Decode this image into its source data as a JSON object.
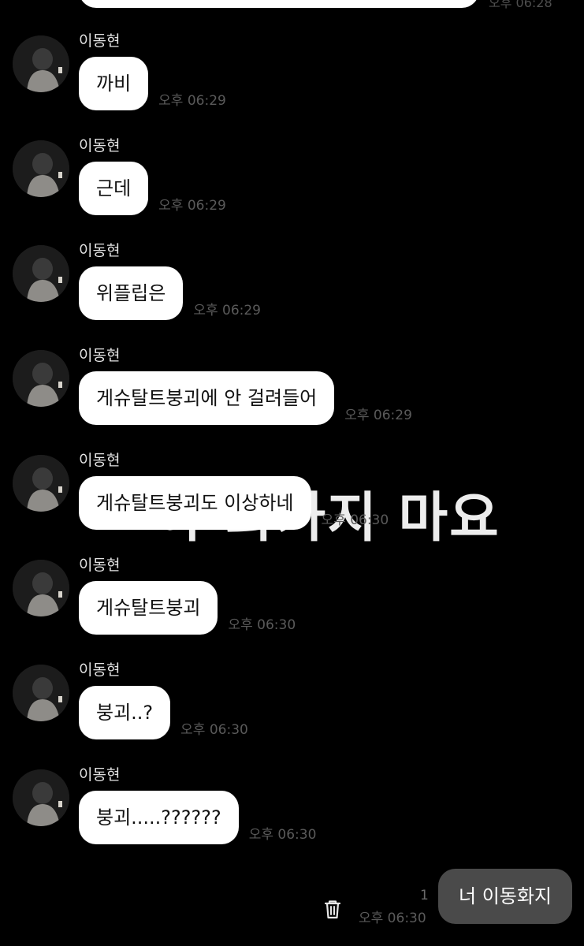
{
  "top": {
    "time_partial": "오후 06:28"
  },
  "messages": [
    {
      "sender": "이동현",
      "text": "까비",
      "time": "오후 06:29"
    },
    {
      "sender": "이동현",
      "text": "근데",
      "time": "오후 06:29"
    },
    {
      "sender": "이동현",
      "text": "위플립은",
      "time": "오후 06:29"
    },
    {
      "sender": "이동현",
      "text": "게슈탈트붕괴에 안 걸려들어",
      "time": "오후 06:29"
    },
    {
      "sender": "이동현",
      "text": "게슈탈트붕괴도 이상하네",
      "time": "오후 06:30"
    },
    {
      "sender": "이동현",
      "text": "게슈탈트붕괴",
      "time": "오후 06:30"
    },
    {
      "sender": "이동현",
      "text": "붕괴..?",
      "time": "오후 06:30"
    },
    {
      "sender": "이동현",
      "text": "붕괴.....??????",
      "time": "오후 06:30"
    }
  ],
  "overlay": {
    "caption": "아 화가지 마요"
  },
  "my_message": {
    "text": "너 이동화지",
    "time": "오후 06:30",
    "unread_count": "1"
  },
  "colors": {
    "background": "#000000",
    "bubble_incoming": "#ffffff",
    "bubble_outgoing": "#4a4a4a",
    "timestamp": "#5a5a5a"
  },
  "icons": {
    "delete": "trash-icon",
    "avatar": "profile-photo"
  }
}
